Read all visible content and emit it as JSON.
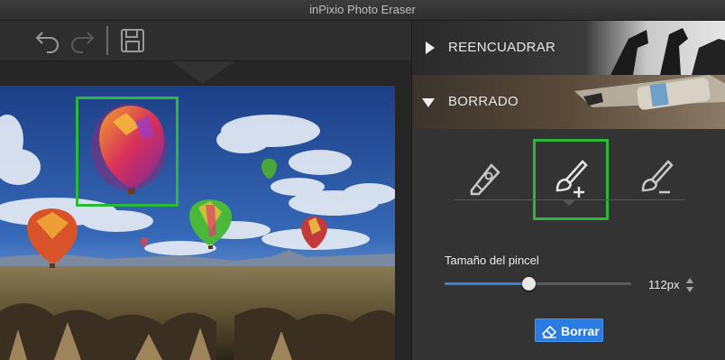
{
  "window": {
    "title": "inPixio Photo Eraser"
  },
  "toolbar": {
    "undo_icon": "undo-arrow-icon",
    "redo_icon": "redo-arrow-icon",
    "save_icon": "floppy-disk-icon"
  },
  "panel": {
    "sections": [
      {
        "label": "REENCUADRAR",
        "expanded": false
      },
      {
        "label": "BORRADO",
        "expanded": true
      }
    ],
    "tools": [
      {
        "name": "eraser-tool",
        "icon": "eraser-pen-icon",
        "selected": false
      },
      {
        "name": "brush-add",
        "icon": "brush-plus-icon",
        "selected": true
      },
      {
        "name": "brush-remove",
        "icon": "brush-minus-icon",
        "selected": false
      }
    ],
    "brush_size": {
      "label": "Tamaño del pincel",
      "value_text": "112px",
      "slider_fraction": 0.45
    },
    "erase_button": {
      "label": "Borrar",
      "icon": "eraser-icon"
    }
  },
  "colors": {
    "accent_blue": "#2a7be2",
    "selection_green": "#2db83c"
  }
}
